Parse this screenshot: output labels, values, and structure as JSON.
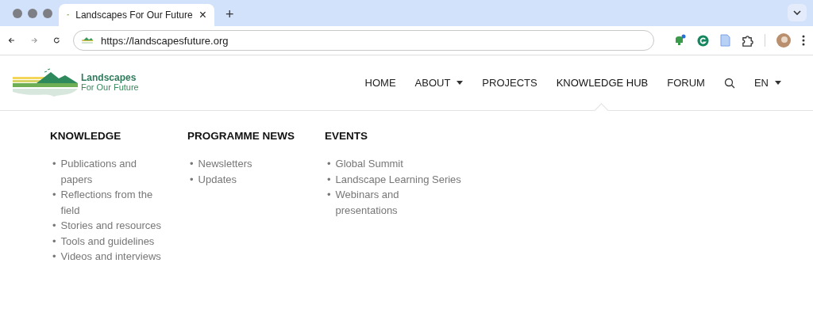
{
  "browser": {
    "tab_title": "Landscapes For Our Future",
    "close": "×",
    "new_tab": "+",
    "url": "https://landscapesfuture.org"
  },
  "logo": {
    "line1": "Landscapes",
    "line2": "For Our Future"
  },
  "nav": [
    {
      "label": "HOME",
      "kind": "link",
      "selected": false
    },
    {
      "label": "ABOUT",
      "kind": "dropdown",
      "selected": false
    },
    {
      "label": "PROJECTS",
      "kind": "link",
      "selected": false
    },
    {
      "label": "KNOWLEDGE HUB",
      "kind": "link",
      "selected": true
    },
    {
      "label": "FORUM",
      "kind": "link",
      "selected": false
    }
  ],
  "language": "EN",
  "menu": [
    {
      "heading": "KNOWLEDGE",
      "items": [
        {
          "bullet": "•",
          "label": "Publications and papers"
        },
        {
          "bullet": "•",
          "label": "Reflections from the field"
        },
        {
          "bullet": "•",
          "label": "Stories and resources"
        },
        {
          "bullet": "•",
          "label": "Tools and guidelines"
        },
        {
          "bullet": "•",
          "label": "Videos and interviews"
        }
      ]
    },
    {
      "heading": "PROGRAMME NEWS",
      "items": [
        {
          "bullet": "•",
          "label": "Newsletters"
        },
        {
          "bullet": "•",
          "label": "Updates"
        }
      ]
    },
    {
      "heading": "EVENTS",
      "items": [
        {
          "bullet": "•",
          "label": "Global Summit"
        },
        {
          "bullet": "•",
          "label": "Landscape Learning Series"
        },
        {
          "bullet": "•",
          "label": "Webinars and presentations"
        }
      ]
    }
  ]
}
